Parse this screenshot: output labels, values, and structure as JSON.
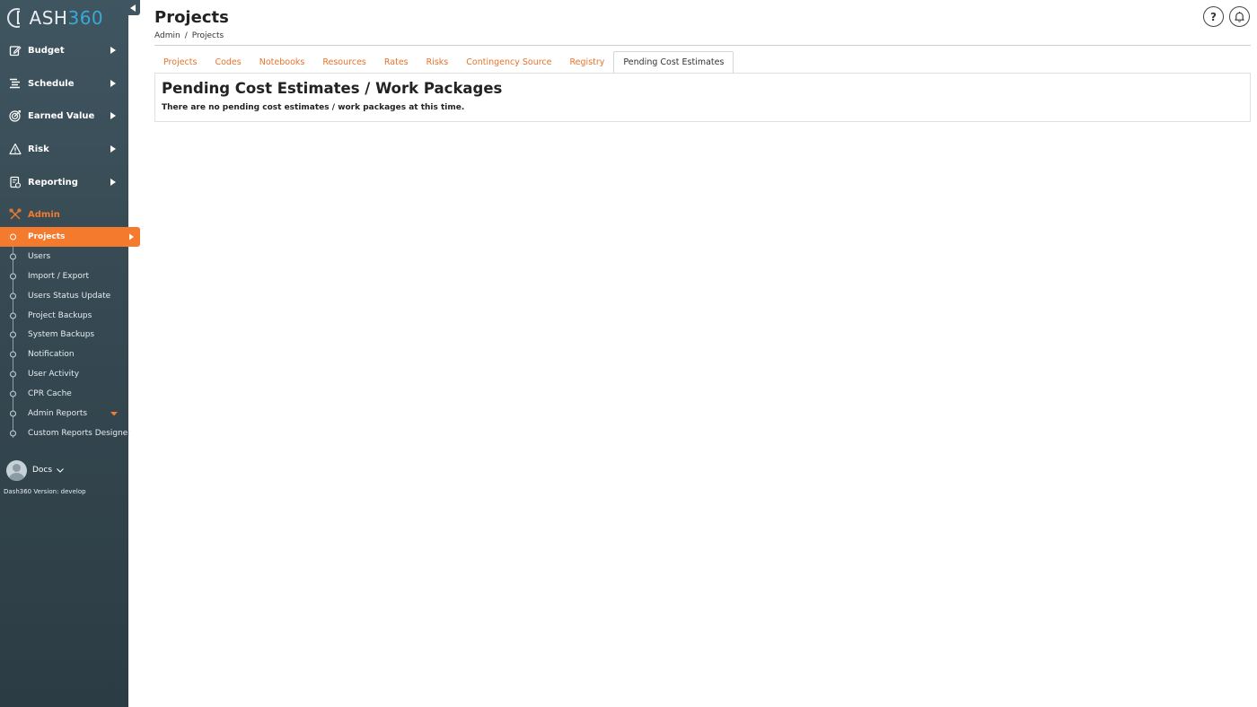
{
  "app": {
    "logo_part1": "DASH",
    "logo_part2": "360",
    "version": "Dash360 Version: develop"
  },
  "sidebar": {
    "menu": [
      {
        "label": "Budget",
        "icon": "edit-icon"
      },
      {
        "label": "Schedule",
        "icon": "list-icon"
      },
      {
        "label": "Earned Value",
        "icon": "target-icon"
      },
      {
        "label": "Risk",
        "icon": "warning-icon"
      },
      {
        "label": "Reporting",
        "icon": "report-icon"
      },
      {
        "label": "Admin",
        "icon": "tools-icon"
      }
    ],
    "admin_items": [
      "Projects",
      "Users",
      "Import / Export",
      "Users Status Update",
      "Project Backups",
      "System Backups",
      "Notification",
      "User Activity",
      "CPR Cache",
      "Admin Reports",
      "Custom Reports Designer"
    ],
    "active_admin_item": "Projects",
    "user": {
      "name": "Docs"
    }
  },
  "header": {
    "title": "Projects",
    "breadcrumb": [
      "Admin",
      "Projects"
    ],
    "help_label": "?"
  },
  "tabs": [
    "Projects",
    "Codes",
    "Notebooks",
    "Resources",
    "Rates",
    "Risks",
    "Contingency Source",
    "Registry",
    "Pending Cost Estimates"
  ],
  "active_tab": "Pending Cost Estimates",
  "panel": {
    "title": "Pending Cost Estimates / Work Packages",
    "message": "There are no pending cost estimates / work packages at this time."
  },
  "colors": {
    "accent": "#f47a2e",
    "sidebar_bg": "#3f5560",
    "logo_secondary": "#39a9d8"
  }
}
